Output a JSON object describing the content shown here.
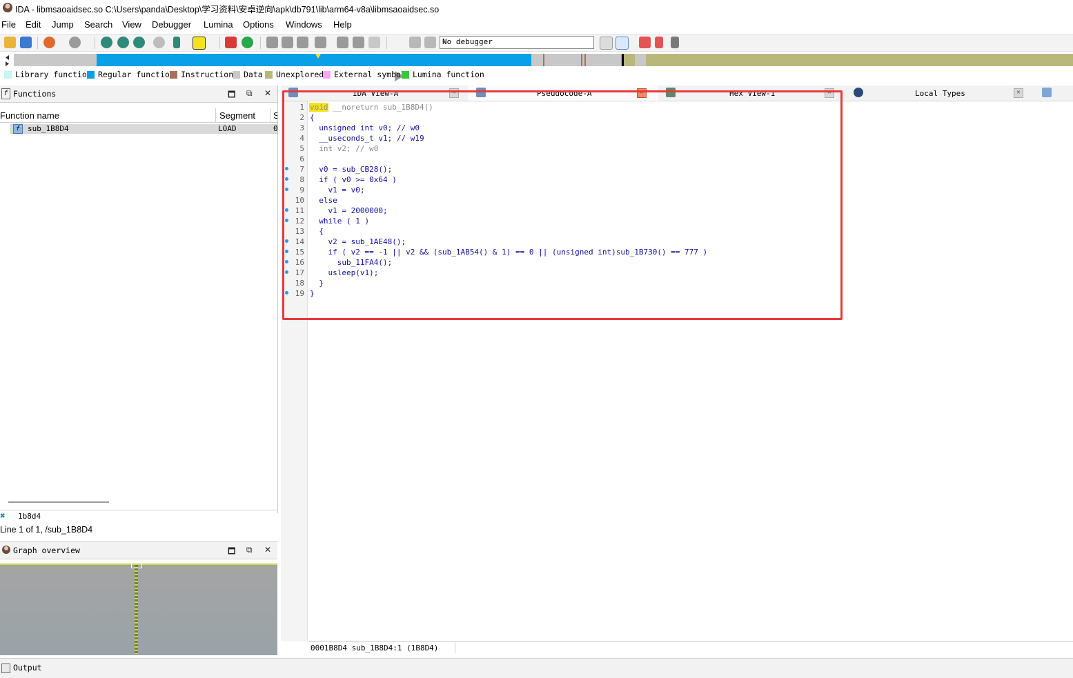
{
  "window": {
    "title": "IDA - libmsaoaidsec.so C:\\Users\\panda\\Desktop\\学习资料\\安卓逆向\\apk\\db791\\lib\\arm64-v8a\\libmsaoaidsec.so",
    "app_icon": "ida-icon"
  },
  "menu": [
    "File",
    "Edit",
    "Jump",
    "Search",
    "View",
    "Debugger",
    "Lumina",
    "Options",
    "Windows",
    "Help"
  ],
  "toolbar": {
    "debugger": "No debugger"
  },
  "legend": [
    {
      "label": "Library function",
      "color": "#c6f6f6"
    },
    {
      "label": "Regular function",
      "color": "#0aa0e8"
    },
    {
      "label": "Instruction",
      "color": "#a8705a"
    },
    {
      "label": "Data",
      "color": "#c8c8c8"
    },
    {
      "label": "Unexplored",
      "color": "#b9b87a"
    },
    {
      "label": "External symbol",
      "color": "#f7a8f7"
    },
    {
      "label": "Lumina function",
      "color": "#36c936"
    }
  ],
  "functions_panel": {
    "title": "Functions",
    "columns": [
      "Function name",
      "Segment",
      "S"
    ],
    "rows": [
      {
        "name": "sub_1B8D4",
        "segment": "LOAD",
        "extra": "0"
      }
    ],
    "filter_value": "1b8d4",
    "status": "Line 1 of 1, /sub_1B8D4"
  },
  "graph_panel": {
    "title": "Graph overview"
  },
  "tabs": [
    {
      "label": "IDA View-A"
    },
    {
      "label": "Pseudocode-A"
    },
    {
      "label": "Hex View-1"
    },
    {
      "label": "Local Types"
    }
  ],
  "code": {
    "line_numbers": [
      "1",
      "2",
      "3",
      "4",
      "5",
      "6",
      "7",
      "8",
      "9",
      "10",
      "11",
      "12",
      "13",
      "14",
      "15",
      "16",
      "17",
      "18",
      "19"
    ],
    "lines": [
      "void __noreturn sub_1B8D4()",
      "{",
      "  unsigned int v0; // w0",
      "  __useconds_t v1; // w19",
      "  int v2; // w0",
      "",
      "  v0 = sub_CB28();",
      "  if ( v0 >= 0x64 )",
      "    v1 = v0;",
      "  else",
      "    v1 = 2000000;",
      "  while ( 1 )",
      "  {",
      "    v2 = sub_1AE48();",
      "    if ( v2 == -1 || v2 && (sub_1AB54() & 1) == 0 || (unsigned int)sub_1B730() == 777 )",
      "      sub_11FA4();",
      "    usleep(v1);",
      "  }",
      "}"
    ],
    "status": "0001B8D4 sub_1B8D4:1 (1B8D4)"
  },
  "output_panel": {
    "title": "Output"
  }
}
